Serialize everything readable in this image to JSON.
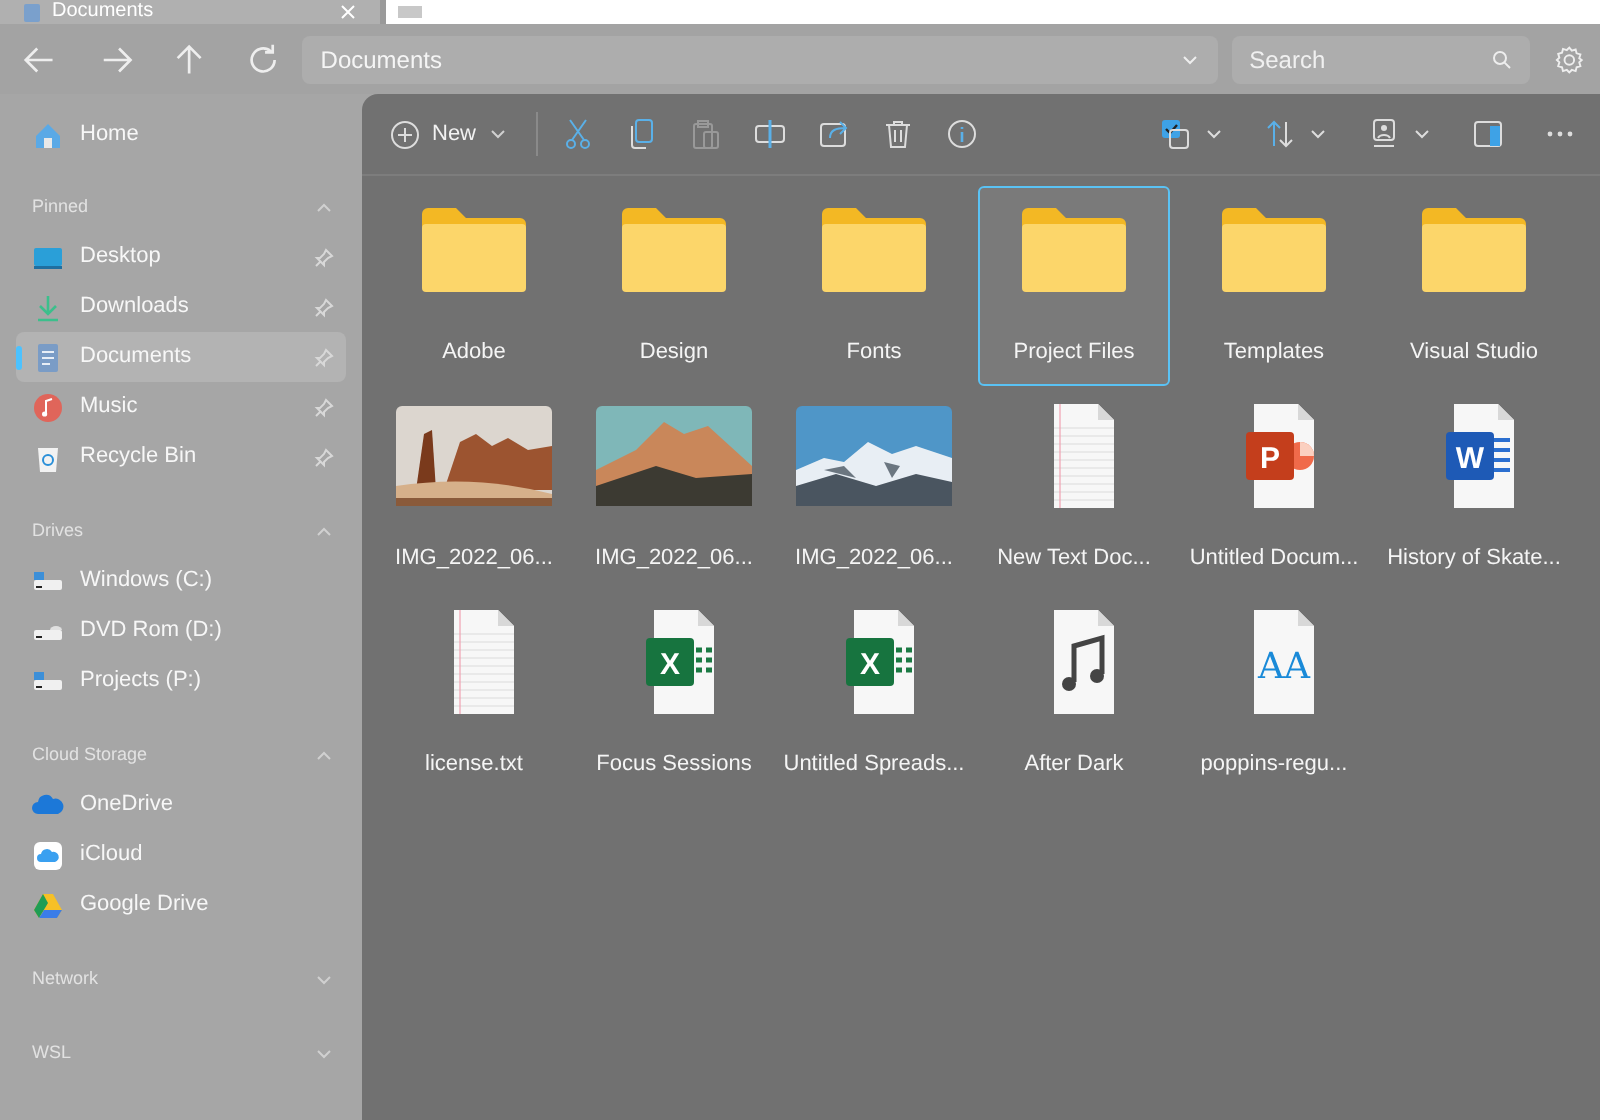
{
  "tabs": [
    {
      "label": "Documents",
      "selected": true
    }
  ],
  "address": {
    "value": "Documents"
  },
  "search": {
    "placeholder": "Search"
  },
  "toolbar": {
    "new_label": "New"
  },
  "sidebar": {
    "home": {
      "label": "Home",
      "selected": false
    },
    "sections": [
      {
        "title": "Pinned",
        "expanded": true,
        "items": [
          {
            "label": "Desktop",
            "kind": "desktop",
            "selected": false,
            "pinned": true
          },
          {
            "label": "Downloads",
            "kind": "downloads",
            "selected": false,
            "pinned": true
          },
          {
            "label": "Documents",
            "kind": "documents",
            "selected": true,
            "pinned": true
          },
          {
            "label": "Music",
            "kind": "music",
            "selected": false,
            "pinned": true
          },
          {
            "label": "Recycle Bin",
            "kind": "recycle",
            "selected": false,
            "pinned": true
          }
        ]
      },
      {
        "title": "Drives",
        "expanded": true,
        "items": [
          {
            "label": "Windows (C:)",
            "kind": "drive",
            "selected": false,
            "pinned": false
          },
          {
            "label": "DVD Rom (D:)",
            "kind": "dvd",
            "selected": false,
            "pinned": false
          },
          {
            "label": "Projects (P:)",
            "kind": "drive",
            "selected": false,
            "pinned": false
          }
        ]
      },
      {
        "title": "Cloud Storage",
        "expanded": true,
        "items": [
          {
            "label": "OneDrive",
            "kind": "onedrive",
            "selected": false,
            "pinned": false
          },
          {
            "label": "iCloud",
            "kind": "icloud",
            "selected": false,
            "pinned": false
          },
          {
            "label": "Google Drive",
            "kind": "gdrive",
            "selected": false,
            "pinned": false
          }
        ]
      },
      {
        "title": "Network",
        "expanded": false
      },
      {
        "title": "WSL",
        "expanded": false
      }
    ]
  },
  "files": [
    {
      "name": "Adobe",
      "kind": "folder",
      "selected": false
    },
    {
      "name": "Design",
      "kind": "folder",
      "selected": false
    },
    {
      "name": "Fonts",
      "kind": "folder",
      "selected": false
    },
    {
      "name": "Project Files",
      "kind": "folder",
      "selected": true
    },
    {
      "name": "Templates",
      "kind": "folder",
      "selected": false
    },
    {
      "name": "Visual Studio",
      "kind": "folder",
      "selected": false
    },
    {
      "name": "IMG_2022_06...",
      "selected": false
    },
    {
      "name": "IMG_2022_06...",
      "selected": false
    },
    {
      "name": "IMG_2022_06...",
      "selected": false
    },
    {
      "name": "New Text Doc...",
      "kind": "text",
      "selected": false
    },
    {
      "name": "Untitled Docum...",
      "kind": "powerpoint",
      "icon_text": "P",
      "selected": false
    },
    {
      "name": "History of Skate...",
      "kind": "word",
      "icon_text": "W",
      "selected": false
    },
    {
      "name": "license.txt",
      "kind": "text",
      "selected": false
    },
    {
      "name": "Focus Sessions",
      "kind": "excel",
      "icon_text": "X",
      "selected": false
    },
    {
      "name": "Untitled Spreads...",
      "kind": "excel",
      "icon_text": "X",
      "selected": false
    },
    {
      "name": "After Dark",
      "kind": "music",
      "selected": false
    },
    {
      "name": "poppins-regu...",
      "kind": "font",
      "icon_text": "AA",
      "selected": false
    }
  ]
}
